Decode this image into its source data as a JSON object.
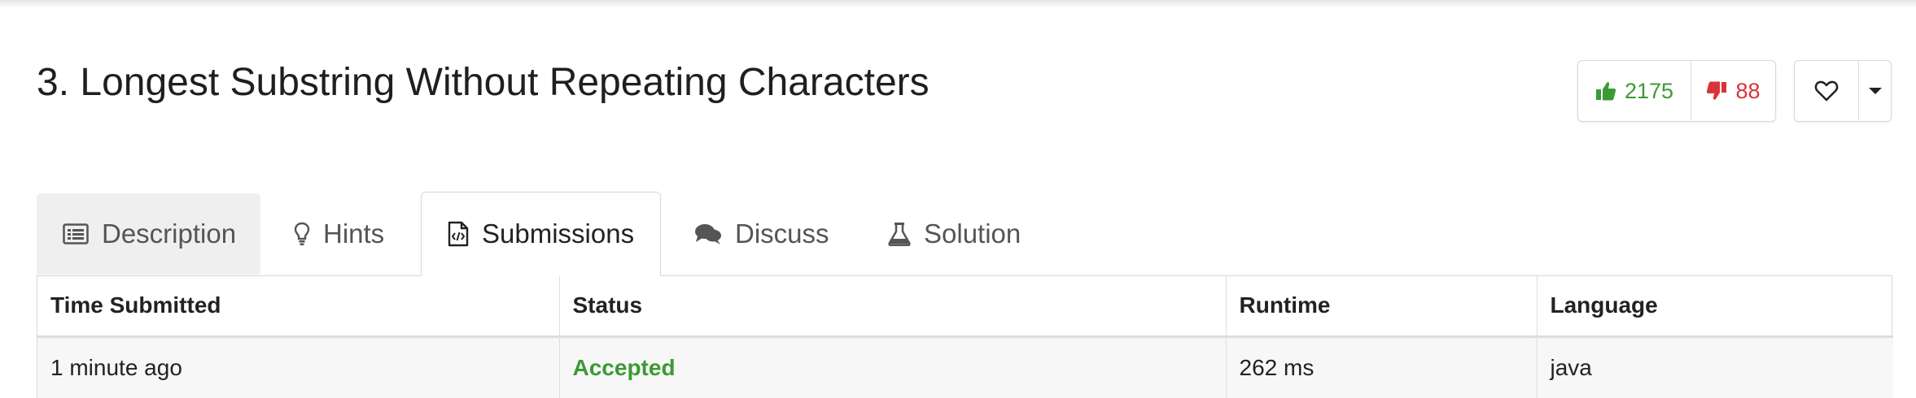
{
  "problem": {
    "title": "3. Longest Substring Without Repeating Characters"
  },
  "votes": {
    "likes": "2175",
    "dislikes": "88",
    "like_color": "#3b9a34",
    "dislike_color": "#d9343a"
  },
  "favorite": {
    "icon": "heart-outline-icon",
    "dropdown_icon": "caret-down-icon"
  },
  "tabs": [
    {
      "label": "Description",
      "icon": "list-icon",
      "active": false
    },
    {
      "label": "Hints",
      "icon": "lightbulb-icon",
      "active": false
    },
    {
      "label": "Submissions",
      "icon": "code-file-icon",
      "active": true
    },
    {
      "label": "Discuss",
      "icon": "comments-icon",
      "active": false
    },
    {
      "label": "Solution",
      "icon": "flask-icon",
      "active": false
    }
  ],
  "submissions": {
    "columns": [
      "Time Submitted",
      "Status",
      "Runtime",
      "Language"
    ],
    "rows": [
      {
        "time": "1 minute ago",
        "status": "Accepted",
        "runtime": "262 ms",
        "language": "java"
      }
    ],
    "accepted_color": "#3b9a34"
  }
}
